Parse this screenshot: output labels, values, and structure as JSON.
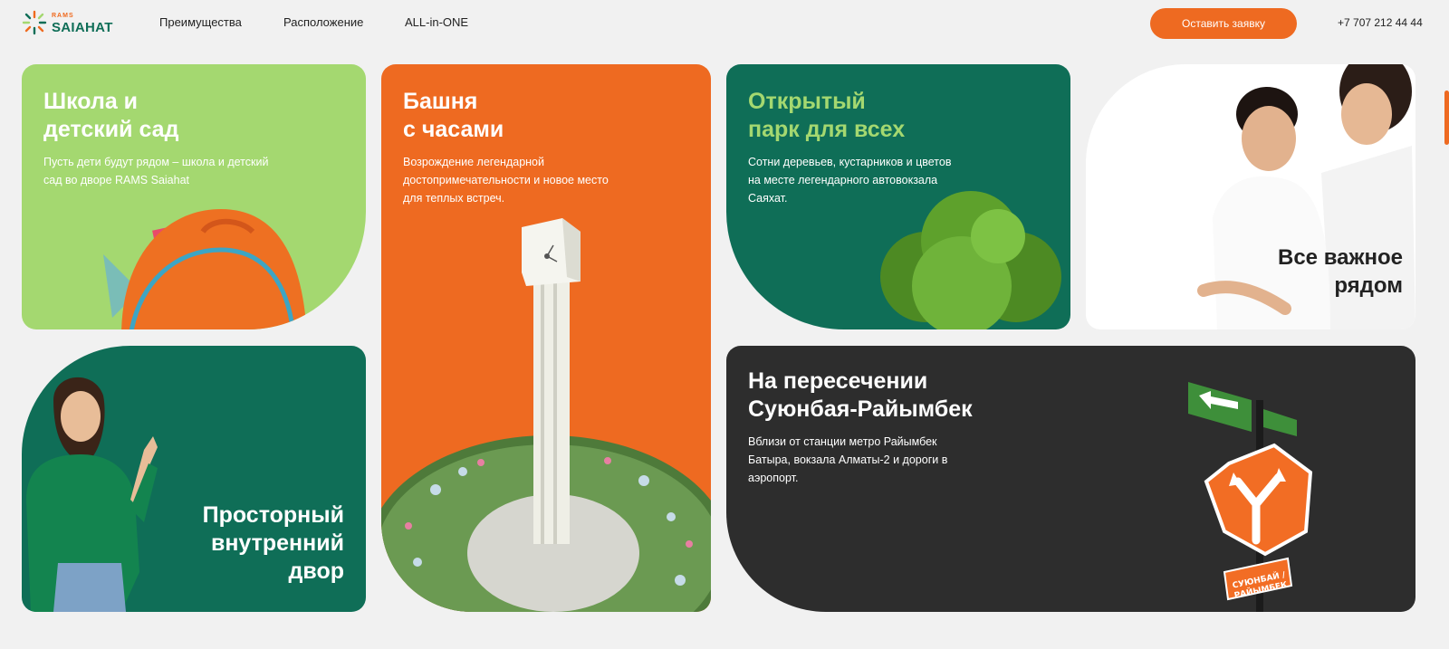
{
  "header": {
    "logo_small": "RAMS",
    "logo_big": "SAIAHAT",
    "nav": [
      "Преимущества",
      "Расположение",
      "ALL-in-ONE"
    ],
    "cta_label": "Оставить заявку",
    "phone": "+7 707 212 44 44"
  },
  "cards": {
    "school": {
      "title_line1": "Школа и",
      "title_line2": "детский сад",
      "text": "Пусть дети будут рядом – школа и детский сад во дворе RAMS Saiahat"
    },
    "tower": {
      "title_line1": "Башня",
      "title_line2": "с часами",
      "text": "Возрождение легендарной достопримечательности и новое место для теплых встреч."
    },
    "park": {
      "title_line1": "Открытый",
      "title_line2": "парк для всех",
      "text": "Сотни деревьев, кустарников и цветов на месте легендарного автовокзала Саяхат."
    },
    "all_near": {
      "title_line1": "Все важное",
      "title_line2": "рядом"
    },
    "yard": {
      "title_line1": "Просторный",
      "title_line2": "внутренний",
      "title_line3": "двор"
    },
    "crossing": {
      "title_line1": "На пересечении",
      "title_line2": "Суюнбая-Райымбек",
      "text": "Вблизи от станции метро Райымбек Батыра, вокзала Алматы-2 и дороги в аэропорт.",
      "sign_line1": "СУЮНБАЙ /",
      "sign_line2": "РАЙЫМБЕК"
    }
  },
  "colors": {
    "accent_orange": "#ee6a21",
    "brand_green": "#0f6e57",
    "light_green": "#a4d870",
    "dark": "#2d2d2d"
  }
}
